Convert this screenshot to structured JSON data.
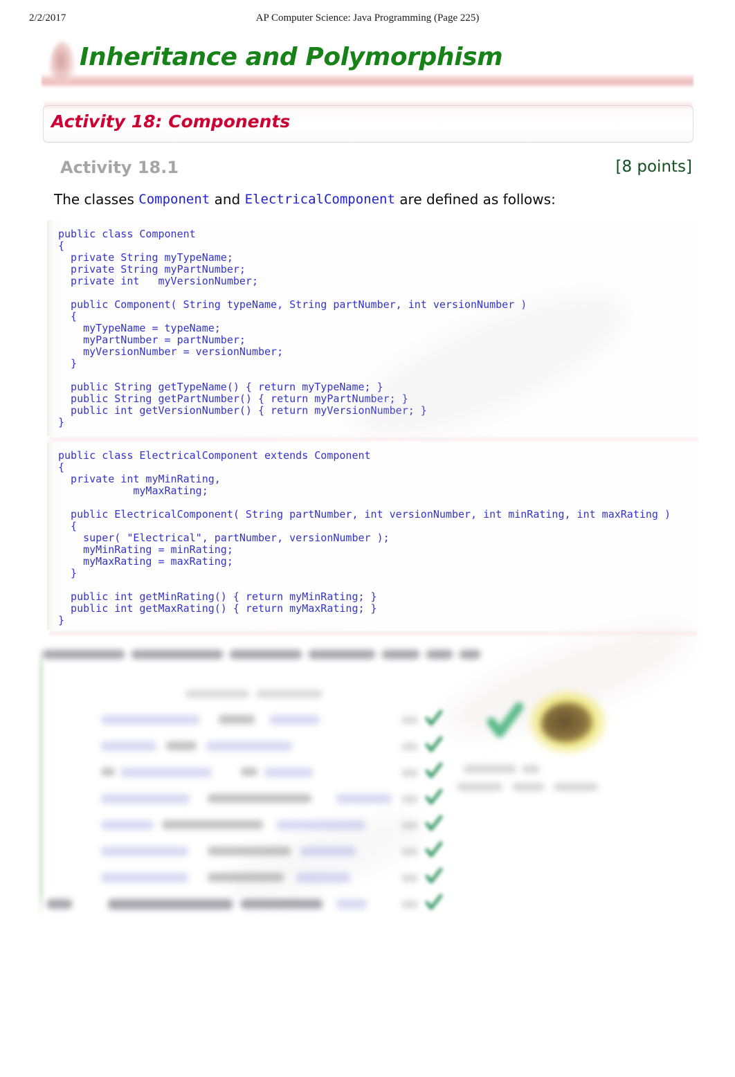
{
  "page_header": {
    "date": "2/2/2017",
    "course": "AP Computer Science: Java Programming (Page 225)"
  },
  "title_banner": {
    "title": "Inheritance and Polymorphism",
    "icon": "flame-blob-icon",
    "title_color": "#178217"
  },
  "activity": {
    "box_title": "Activity 18: Components",
    "box_title_color": "#cc0033",
    "sub_label": "Activity 18.1",
    "sub_label_color": "#a6a6a6",
    "points": "[8 points]",
    "points_color": "#14501e"
  },
  "intro": {
    "part1": "The classes ",
    "class1": "Component",
    "part2": " and ",
    "class2": "ElectricalComponent",
    "part3": " are defined as follows:",
    "code_color": "#2222cc"
  },
  "code_blocks": [
    {
      "name": "component-class",
      "language": "java",
      "text": "public class Component\n{\n  private String myTypeName;\n  private String myPartNumber;\n  private int   myVersionNumber;\n\n  public Component( String typeName, String partNumber, int versionNumber )\n  {\n    myTypeName = typeName;\n    myPartNumber = partNumber;\n    myVersionNumber = versionNumber;\n  }\n\n  public String getTypeName() { return myTypeName; }\n  public String getPartNumber() { return myPartNumber; }\n  public int getVersionNumber() { return myVersionNumber; }\n}"
    },
    {
      "name": "electrical-component-class",
      "language": "java",
      "text": "public class ElectricalComponent extends Component\n{\n  private int myMinRating,\n            myMaxRating;\n\n  public ElectricalComponent( String partNumber, int versionNumber, int minRating, int maxRating )\n  {\n    super( \"Electrical\", partNumber, versionNumber );\n    myMinRating = minRating;\n    myMaxRating = maxRating;\n  }\n\n  public int getMinRating() { return myMinRating; }\n  public int getMaxRating() { return myMaxRating; }\n}"
    }
  ],
  "redacted_section": {
    "note": "lower portion of the page is blurred and illegible",
    "icons": [
      "check-mark-icon",
      "light-bulb-icon"
    ]
  }
}
